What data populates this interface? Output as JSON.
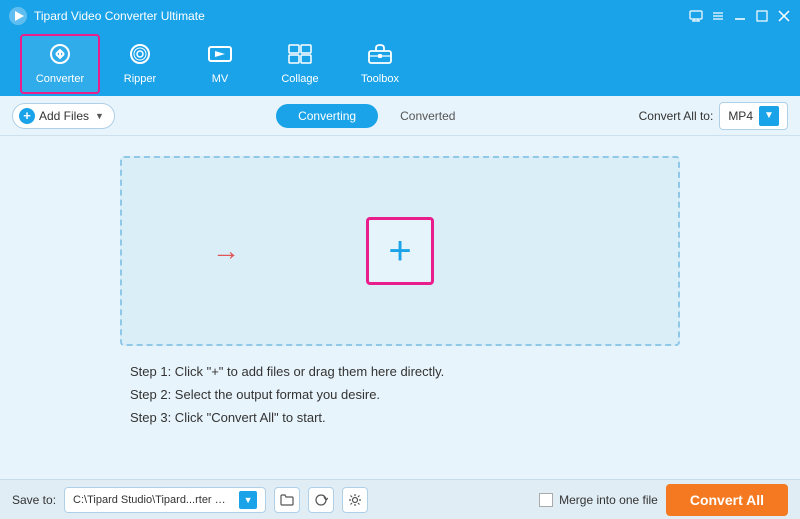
{
  "titleBar": {
    "appTitle": "Tipard Video Converter Ultimate",
    "controls": [
      "monitor-icon",
      "menu-icon",
      "minimize-icon",
      "maximize-icon",
      "close-icon"
    ]
  },
  "navBar": {
    "items": [
      {
        "id": "converter",
        "label": "Converter",
        "active": true
      },
      {
        "id": "ripper",
        "label": "Ripper",
        "active": false
      },
      {
        "id": "mv",
        "label": "MV",
        "active": false
      },
      {
        "id": "collage",
        "label": "Collage",
        "active": false
      },
      {
        "id": "toolbox",
        "label": "Toolbox",
        "active": false
      }
    ]
  },
  "toolbar": {
    "addFilesLabel": "Add Files",
    "tabs": [
      {
        "id": "converting",
        "label": "Converting",
        "active": true
      },
      {
        "id": "converted",
        "label": "Converted",
        "active": false
      }
    ],
    "convertAllToLabel": "Convert All to:",
    "selectedFormat": "MP4"
  },
  "dropZone": {
    "plusSymbol": "+"
  },
  "steps": [
    "Step 1: Click \"+\" to add files or drag them here directly.",
    "Step 2: Select the output format you desire.",
    "Step 3: Click \"Convert All\" to start."
  ],
  "bottomBar": {
    "saveToLabel": "Save to:",
    "savePath": "C:\\Tipard Studio\\Tipard...rter Ultimate\\Converted",
    "mergeLabel": "Merge into one file",
    "convertAllLabel": "Convert All"
  }
}
